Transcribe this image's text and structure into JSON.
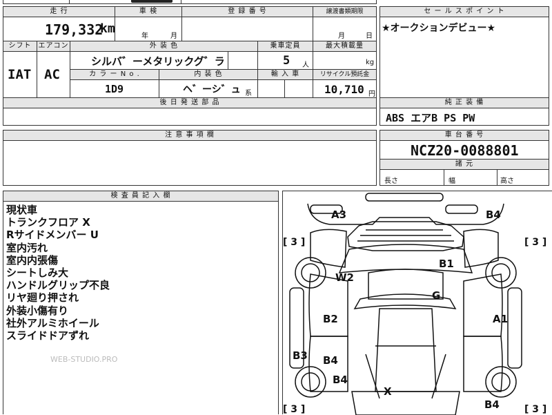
{
  "header_top_partial": "",
  "mileage": {
    "label": "走 行",
    "value": "179,332",
    "unit": "km"
  },
  "inspection": {
    "label": "車 検",
    "year_unit": "年",
    "month_unit": "月"
  },
  "registration": {
    "label": "登 録 番 号",
    "value": ""
  },
  "transfer_deadline": {
    "label": "譲渡書類期限",
    "month_unit": "月",
    "day_unit": "日"
  },
  "shift": {
    "label": "シフト",
    "value": "IAT"
  },
  "aircon": {
    "label": "エアコン",
    "value": "AC"
  },
  "exterior_color": {
    "label": "外 装 色",
    "value": "シルバ゛ーメタリックグ゛ラファイ"
  },
  "capacity": {
    "label": "乗車定員",
    "value": "5",
    "unit": "人"
  },
  "max_load": {
    "label": "最大積載量",
    "value": "",
    "unit": "kg"
  },
  "color_no": {
    "label": "カ ラ ー N o .",
    "value": "1D9"
  },
  "interior_color": {
    "label": "内 装 色",
    "value": "ヘ゛ーシ゛ュ",
    "suffix": "系"
  },
  "import_car": {
    "label": "輸 入 車",
    "value": ""
  },
  "recycle": {
    "label": "リサイクル預託金",
    "value": "10,710",
    "unit": "円"
  },
  "delivery_parts": {
    "label": "後 日 発 送 部 品",
    "value": ""
  },
  "notes": {
    "label": "注 意 事 項 欄",
    "value": ""
  },
  "sales_point": {
    "label": "セ ー ル ス ポ イ ン ト",
    "value": "★オークションデビュー★"
  },
  "factory_equipment": {
    "label": "純 正 装 備",
    "value": "ABS エアB PS PW"
  },
  "chassis_number": {
    "label": "車 台 番 号",
    "value": "NCZ20-0088801"
  },
  "dimensions": {
    "label": "諸 元",
    "length_label": "長さ",
    "width_label": "幅",
    "height_label": "高さ"
  },
  "inspector_notes": {
    "label": "検 査 員 記 入 欄",
    "items": [
      "現状車",
      "トランクフロア X",
      "Rサイドメンバー U",
      "室内汚れ",
      "室内内張傷",
      "シートしみ大",
      "ハンドルグリップ不良",
      "リヤ廻り押され",
      "外装小傷有り",
      "社外アルミホイール",
      "スライドドアずれ"
    ]
  },
  "watermark": "WEB-STUDIO.PRO",
  "damage_map": {
    "marks": [
      "A3",
      "B4",
      "B1",
      "W2",
      "G",
      "B2",
      "A1",
      "B3",
      "B4",
      "B4",
      "X",
      "B4"
    ],
    "tire_ratings": [
      "[ 3 ]",
      "[ 3 ]",
      "[ 3 ]",
      "[ 3 ]"
    ]
  }
}
